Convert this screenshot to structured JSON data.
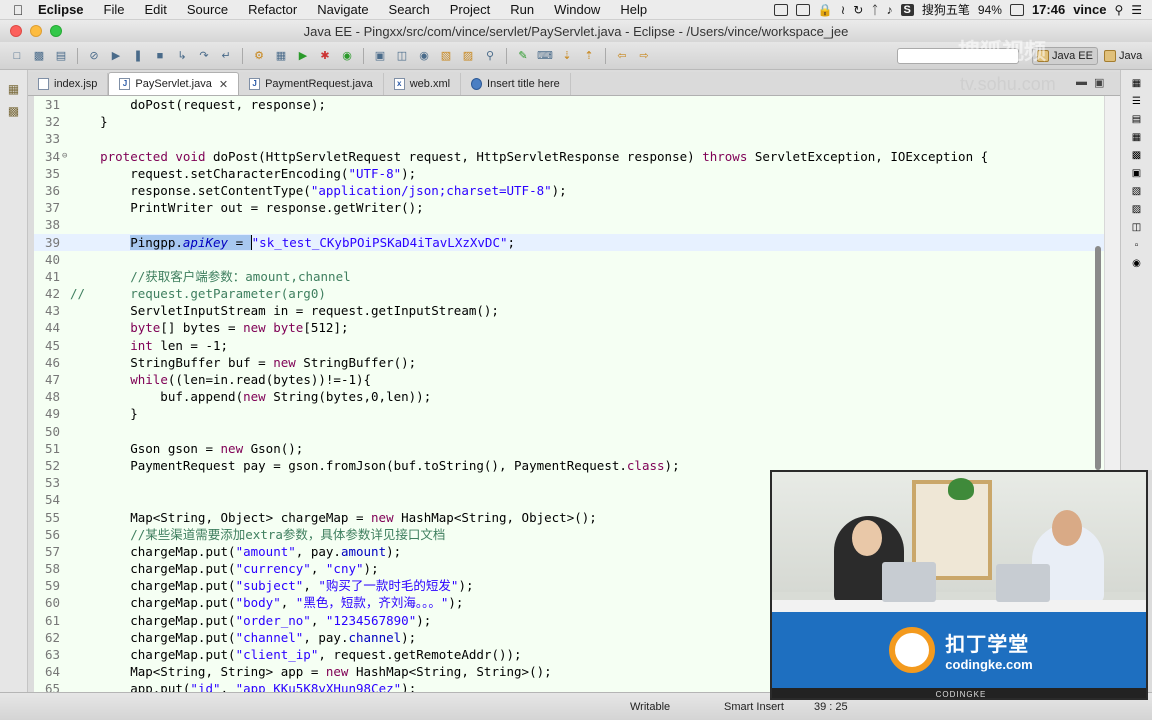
{
  "menubar": {
    "app": "Eclipse",
    "items": [
      "File",
      "Edit",
      "Source",
      "Refactor",
      "Navigate",
      "Search",
      "Project",
      "Run",
      "Window",
      "Help"
    ],
    "input_method": "搜狗五笔",
    "battery": "94%",
    "time": "17:46",
    "user": "vince"
  },
  "window": {
    "title": "Java EE - Pingxx/src/com/vince/servlet/PayServlet.java - Eclipse - /Users/vince/workspace_jee"
  },
  "toolbar": {
    "perspectives": [
      "Java EE",
      "Java"
    ]
  },
  "tabs": [
    {
      "label": "index.jsp",
      "icon": "file-icon",
      "active": false
    },
    {
      "label": "PayServlet.java",
      "icon": "java-file-icon",
      "active": true
    },
    {
      "label": "PaymentRequest.java",
      "icon": "java-file-icon",
      "active": false
    },
    {
      "label": "web.xml",
      "icon": "xml-file-icon",
      "active": false
    },
    {
      "label": "Insert title here",
      "icon": "globe-icon",
      "active": false
    }
  ],
  "editor": {
    "lines": [
      {
        "n": "31",
        "html": "        doPost(request, response);"
      },
      {
        "n": "32",
        "html": "    }"
      },
      {
        "n": "33",
        "html": ""
      },
      {
        "n": "34",
        "marker": "⊖",
        "html": "    <span class=\"kw\">protected</span> <span class=\"kw\">void</span> doPost(HttpServletRequest request, HttpServletResponse response) <span class=\"kw\">throws</span> ServletException, IOException {"
      },
      {
        "n": "35",
        "html": "        request.setCharacterEncoding(<span class=\"str\">\"UTF-8\"</span>);"
      },
      {
        "n": "36",
        "html": "        response.setContentType(<span class=\"str\">\"application/json;charset=UTF-8\"</span>);"
      },
      {
        "n": "37",
        "html": "        PrintWriter out = response.getWriter();"
      },
      {
        "n": "38",
        "html": ""
      },
      {
        "n": "39",
        "highlight": true,
        "html": "        <span class=\"sel\">Pingpp.<span class=\"it\">apiKey</span> = </span><span class=\"caret\"></span><span class=\"str\">\"sk_test_CKybPOiPSKaD4iTavLXzXvDC\"</span>;"
      },
      {
        "n": "40",
        "html": ""
      },
      {
        "n": "41",
        "html": "        <span class=\"cm\">//获取客户端参数：amount,channel</span>"
      },
      {
        "n": "42",
        "html": "<span class=\"cm\">//      request.getParameter(arg0)</span>"
      },
      {
        "n": "43",
        "html": "        ServletInputStream in = request.getInputStream();"
      },
      {
        "n": "44",
        "html": "        <span class=\"kw\">byte</span>[] bytes = <span class=\"kw\">new</span> <span class=\"kw\">byte</span>[512];"
      },
      {
        "n": "45",
        "html": "        <span class=\"kw\">int</span> len = -1;"
      },
      {
        "n": "46",
        "html": "        StringBuffer buf = <span class=\"kw\">new</span> StringBuffer();"
      },
      {
        "n": "47",
        "html": "        <span class=\"kw\">while</span>((len=in.read(bytes))!=-1){"
      },
      {
        "n": "48",
        "html": "            buf.append(<span class=\"kw\">new</span> String(bytes,0,len));"
      },
      {
        "n": "49",
        "html": "        }"
      },
      {
        "n": "50",
        "html": ""
      },
      {
        "n": "51",
        "html": "        Gson gson = <span class=\"kw\">new</span> Gson();"
      },
      {
        "n": "52",
        "html": "        PaymentRequest pay = gson.fromJson(buf.toString(), PaymentRequest.<span class=\"kw\">class</span>);"
      },
      {
        "n": "53",
        "html": ""
      },
      {
        "n": "54",
        "html": ""
      },
      {
        "n": "55",
        "html": "        Map&lt;String, Object&gt; chargeMap = <span class=\"kw\">new</span> HashMap&lt;String, Object&gt;();"
      },
      {
        "n": "56",
        "html": "        <span class=\"cm\">//某些渠道需要添加extra参数，具体参数详见接口文档</span>"
      },
      {
        "n": "57",
        "html": "        chargeMap.put(<span class=\"str\">\"amount\"</span>, pay.<span class=\"fld\">amount</span>);"
      },
      {
        "n": "58",
        "html": "        chargeMap.put(<span class=\"str\">\"currency\"</span>, <span class=\"str\">\"cny\"</span>);"
      },
      {
        "n": "59",
        "html": "        chargeMap.put(<span class=\"str\">\"subject\"</span>, <span class=\"str\">\"购买了一款时毛的短发\"</span>);"
      },
      {
        "n": "60",
        "html": "        chargeMap.put(<span class=\"str\">\"body\"</span>, <span class=\"str\">\"黑色，短款，齐刘海。。。\"</span>);"
      },
      {
        "n": "61",
        "html": "        chargeMap.put(<span class=\"str\">\"order_no\"</span>, <span class=\"str\">\"1234567890\"</span>);"
      },
      {
        "n": "62",
        "html": "        chargeMap.put(<span class=\"str\">\"channel\"</span>, pay.<span class=\"fld\">channel</span>);"
      },
      {
        "n": "63",
        "html": "        chargeMap.put(<span class=\"str\">\"client_ip\"</span>, request.getRemoteAddr());"
      },
      {
        "n": "64",
        "html": "        Map&lt;String, String&gt; app = <span class=\"kw\">new</span> HashMap&lt;String, String&gt;();"
      },
      {
        "n": "65",
        "html": "        app.put(<span class=\"str\">\"id\"</span>, <span class=\"str\">\"app_KKu5K8vXHun98Cez\"</span>);"
      }
    ]
  },
  "statusbar": {
    "writable": "Writable",
    "insert_mode": "Smart Insert",
    "position": "39 : 25"
  },
  "video": {
    "brand_cn": "扣丁学堂",
    "brand_en": "codingke.com",
    "footer": "CODINGKE"
  },
  "watermark": {
    "text": "搜狐视频",
    "url": "tv.sohu.com"
  },
  "colors": {
    "editor_bg": "#f5fff3",
    "current_line": "#e7f1ff",
    "keyword": "#7f0055",
    "string": "#2a00ff",
    "comment": "#3f7f5f",
    "field": "#0000c0",
    "video_banner": "#1e6fc0"
  }
}
